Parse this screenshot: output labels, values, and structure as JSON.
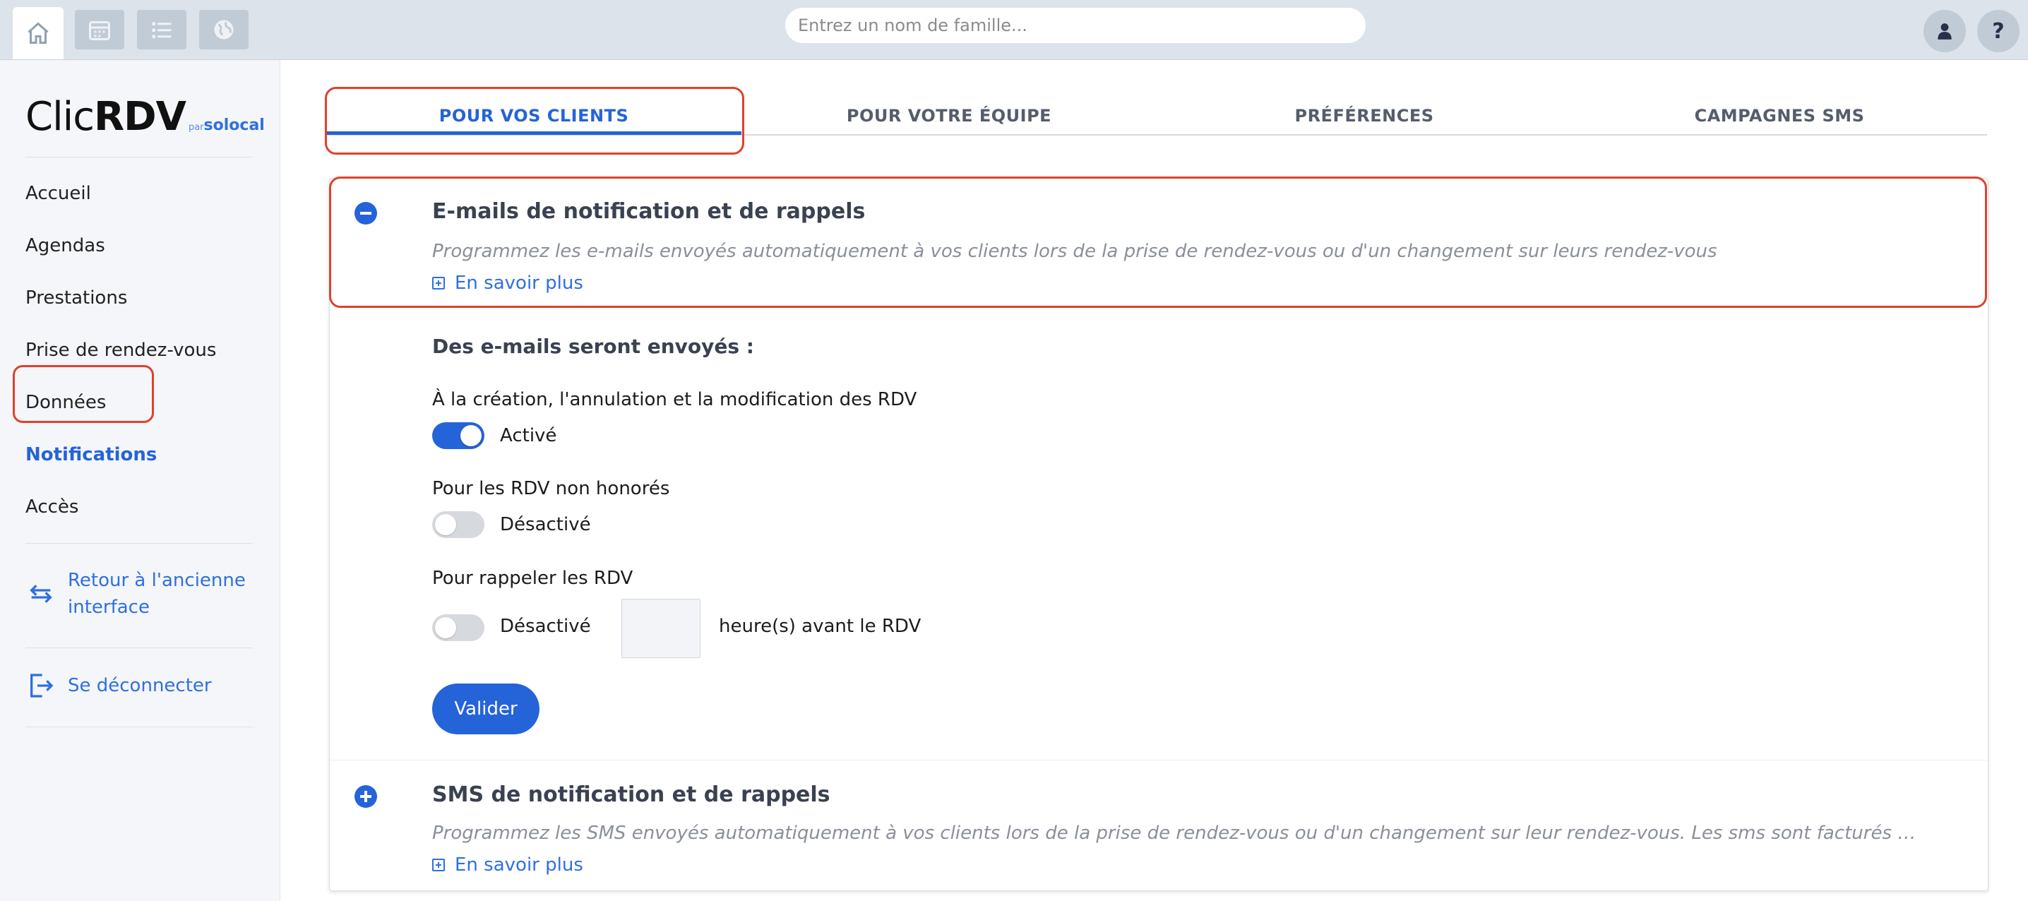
{
  "topbar": {
    "buttons": [
      {
        "icon": "home-icon",
        "active": true
      },
      {
        "icon": "calendar-icon",
        "active": false
      },
      {
        "icon": "list-icon",
        "active": false
      },
      {
        "icon": "globe-icon",
        "active": false
      }
    ],
    "search_placeholder": "Entrez un nom de famille...",
    "user_icon": "user-icon",
    "help_label": "?"
  },
  "sidebar": {
    "logo": {
      "clic": "Clic",
      "rdv": "RDV",
      "par": "par",
      "solocal": "solocal"
    },
    "items": [
      {
        "label": "Accueil",
        "active": false
      },
      {
        "label": "Agendas",
        "active": false
      },
      {
        "label": "Prestations",
        "active": false
      },
      {
        "label": "Prise de rendez-vous",
        "active": false
      },
      {
        "label": "Données",
        "active": false
      },
      {
        "label": "Notifications",
        "active": true
      },
      {
        "label": "Accès",
        "active": false
      }
    ],
    "back_link": {
      "line1": "Retour à l'ancienne",
      "line2": "interface"
    },
    "logout_link": "Se déconnecter"
  },
  "tabs": [
    {
      "label": "POUR VOS CLIENTS",
      "active": true
    },
    {
      "label": "POUR VOTRE ÉQUIPE",
      "active": false
    },
    {
      "label": "PRÉFÉRENCES",
      "active": false
    },
    {
      "label": "CAMPAGNES SMS",
      "active": false
    }
  ],
  "email_section": {
    "title": "E-mails de notification et de rappels",
    "description": "Programmez les e-mails envoyés automatiquement à vos clients lors de la prise de rendez-vous ou d'un changement sur leurs rendez-vous",
    "more": "En savoir plus",
    "subtitle": "Des e-mails seront envoyés :",
    "options": [
      {
        "label": "À la création, l'annulation et la modification des RDV",
        "state": "Activé",
        "on": true
      },
      {
        "label": "Pour les RDV non honorés",
        "state": "Désactivé",
        "on": false
      },
      {
        "label": "Pour rappeler les RDV",
        "state": "Désactivé",
        "on": false
      }
    ],
    "hours_value": "",
    "hours_suffix": "heure(s) avant le RDV",
    "submit": "Valider"
  },
  "sms_section": {
    "title": "SMS de notification et de rappels",
    "description": "Programmez les SMS envoyés automatiquement à vos clients lors de la prise de rendez-vous ou d'un changement sur leur rendez-vous. Les sms sont facturés à la cons...",
    "more": "En savoir plus"
  },
  "colors": {
    "accent": "#2563d8",
    "highlight": "#e0412d",
    "topbar": "#dce3ea"
  }
}
